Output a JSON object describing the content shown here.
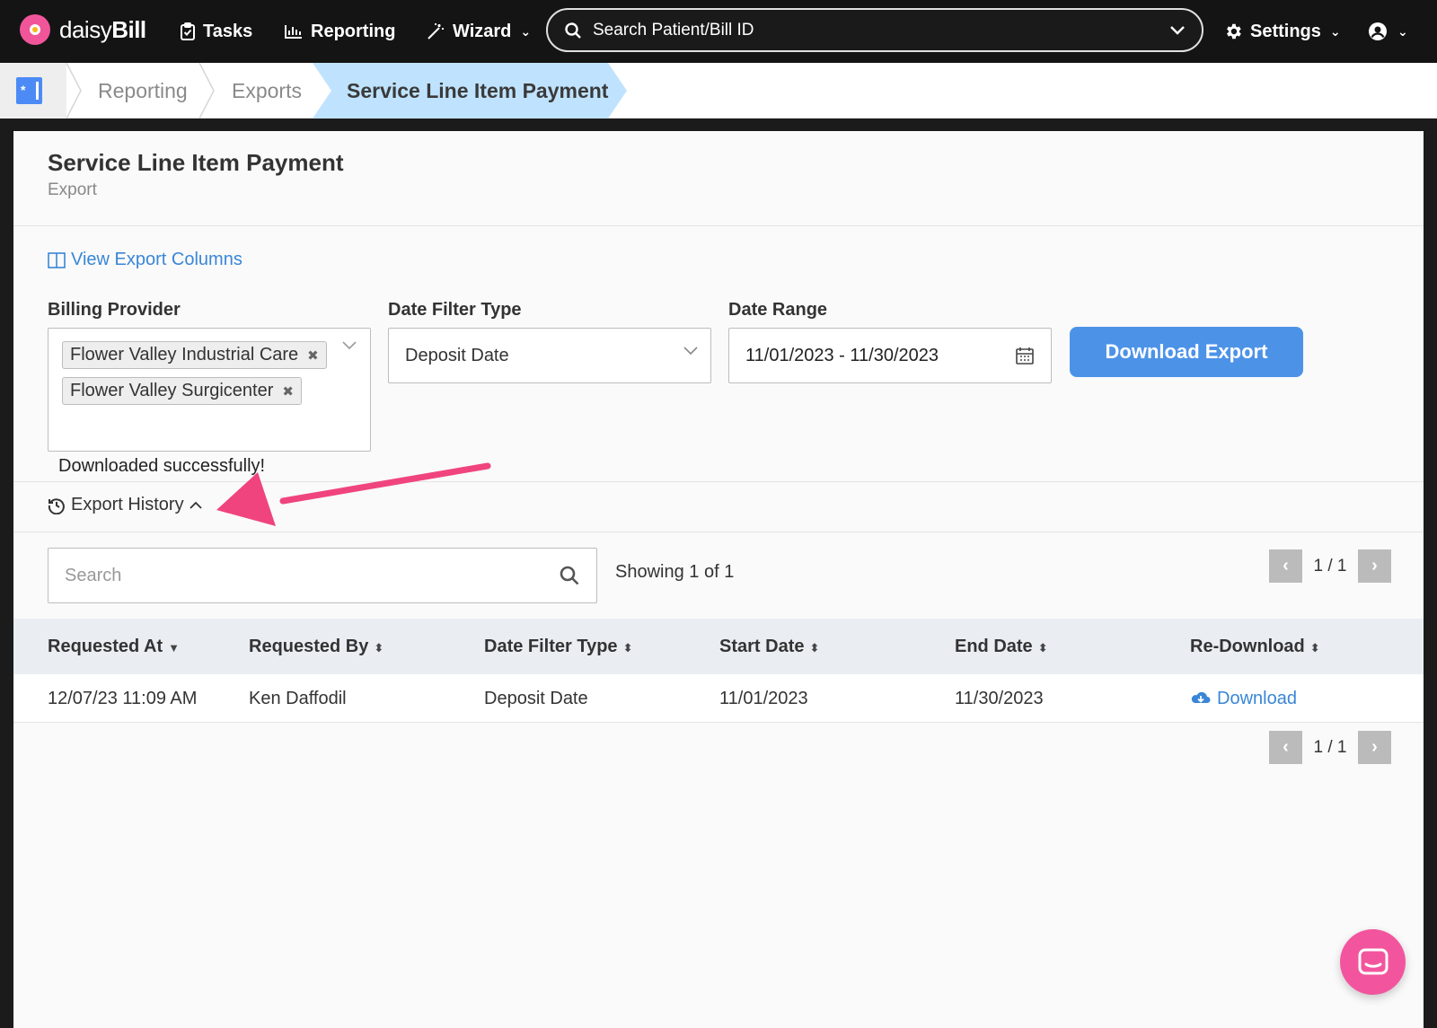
{
  "app": {
    "logo_text_light": "daisy",
    "logo_text_bold": "Bill"
  },
  "nav": {
    "tasks": "Tasks",
    "reporting": "Reporting",
    "wizard": "Wizard",
    "search_placeholder": "Search Patient/Bill ID",
    "settings": "Settings"
  },
  "breadcrumb": {
    "items": [
      "Reporting",
      "Exports"
    ],
    "active": "Service Line Item Payment"
  },
  "page": {
    "title": "Service Line Item Payment",
    "subtitle": "Export",
    "view_columns_link": "View Export Columns"
  },
  "form": {
    "billing_provider_label": "Billing Provider",
    "billing_providers": [
      "Flower Valley Industrial Care",
      "Flower Valley Surgicenter"
    ],
    "date_filter_type_label": "Date Filter Type",
    "date_filter_type_value": "Deposit Date",
    "date_range_label": "Date Range",
    "date_range_value": "11/01/2023 - 11/30/2023",
    "download_button": "Download Export",
    "success_message": "Downloaded successfully!"
  },
  "history": {
    "toggle_label": "Export History",
    "search_placeholder": "Search",
    "showing": "Showing 1 of 1",
    "page_label": "1 / 1",
    "columns": [
      "Requested At",
      "Requested By",
      "Date Filter Type",
      "Start Date",
      "End Date",
      "Re-Download"
    ],
    "rows": [
      {
        "requested_at": "12/07/23 11:09 AM",
        "requested_by": "Ken Daffodil",
        "date_filter_type": "Deposit Date",
        "start_date": "11/01/2023",
        "end_date": "11/30/2023",
        "download": "Download"
      }
    ]
  },
  "colors": {
    "nav_bg": "#141414",
    "accent_blue": "#4c93e8",
    "link_blue": "#3a86d6",
    "breadcrumb_active": "#bfe3ff",
    "annotation_arrow": "#f0447f",
    "chat_button": "#f2559d"
  },
  "icons": {
    "tasks": "clipboard-check-icon",
    "reporting": "bar-chart-icon",
    "wizard": "magic-wand-icon",
    "search": "search-icon",
    "settings": "gear-icon",
    "account": "user-circle-icon",
    "columns": "columns-icon",
    "calendar": "calendar-icon",
    "history": "history-icon",
    "cloud_download": "cloud-download-icon",
    "chat": "chat-icon"
  }
}
